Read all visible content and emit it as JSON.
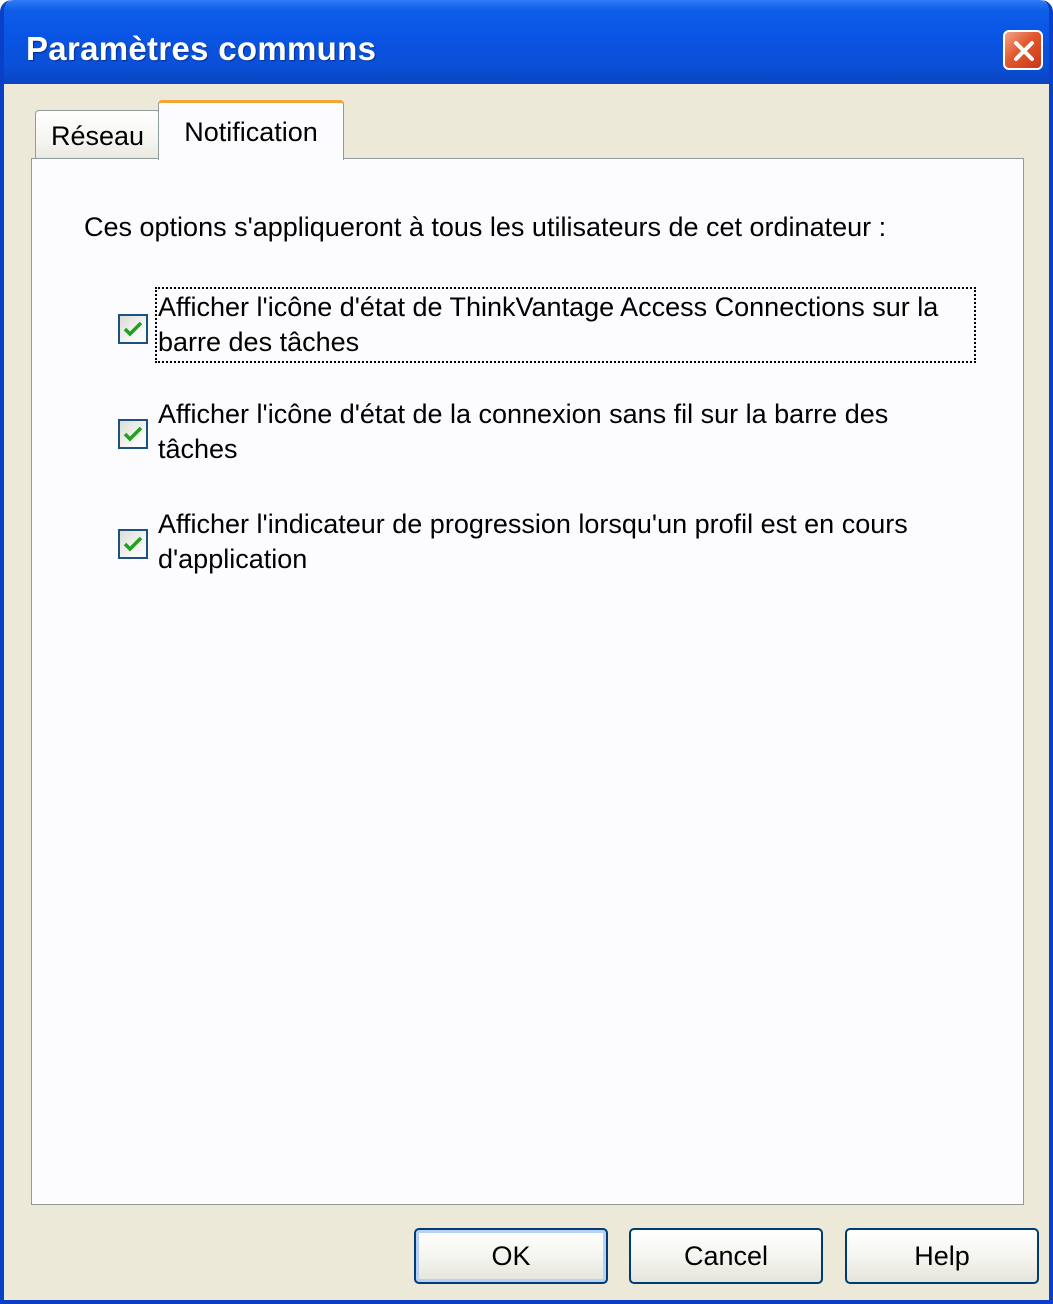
{
  "window": {
    "title": "Paramètres communs"
  },
  "tabs": [
    {
      "label": "Réseau",
      "active": false
    },
    {
      "label": "Notification",
      "active": true
    }
  ],
  "content": {
    "intro": "Ces options s'appliqueront à tous les utilisateurs de cet ordinateur :",
    "options": [
      {
        "label": "Afficher l'icône d'état de ThinkVantage Access Connections sur la barre des tâches",
        "checked": true
      },
      {
        "label": "Afficher l'icône d'état de la connexion sans fil sur la barre des tâches",
        "checked": true
      },
      {
        "label": "Afficher l'indicateur de progression lorsqu'un profil est en cours d'application",
        "checked": true
      }
    ]
  },
  "buttons": {
    "ok": "OK",
    "cancel": "Cancel",
    "help": "Help"
  },
  "colors": {
    "titlebar": "#0955e5",
    "dialog_bg": "#ece9d8",
    "active_tab_accent": "#f3a634",
    "check_mark": "#21a121"
  },
  "icons": {
    "close": "close-icon",
    "check": "check-icon"
  }
}
